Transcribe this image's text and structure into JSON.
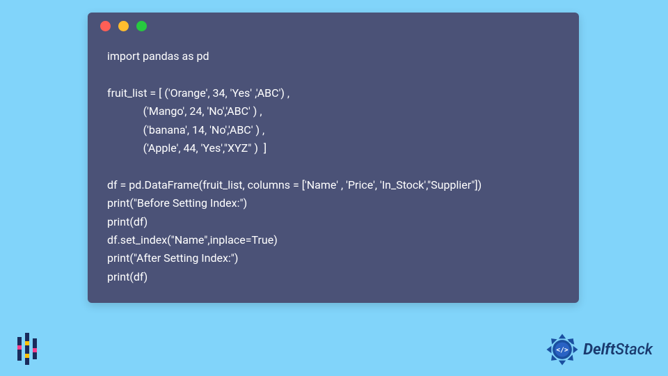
{
  "window": {
    "buttons": {
      "close": "red",
      "minimize": "yellow",
      "zoom": "green"
    }
  },
  "code": {
    "line1": "import pandas as pd",
    "blank1": "",
    "line2": "fruit_list = [ ('Orange', 34, 'Yes' ,'ABC') ,",
    "line3": "             ('Mango', 24, 'No','ABC' ) ,",
    "line4": "             ('banana', 14, 'No','ABC' ) ,",
    "line5": "             ('Apple', 44, 'Yes',\"XYZ\" )  ]",
    "blank2": "",
    "line6": "df = pd.DataFrame(fruit_list, columns = ['Name' , 'Price', 'In_Stock',\"Supplier\"])",
    "line7": "print(\"Before Setting Index:\")",
    "line8": "print(df)",
    "line9": "df.set_index(\"Name\",inplace=True)",
    "line10": "print(\"After Setting Index:\")",
    "line11": "print(df)"
  },
  "branding": {
    "delft": "Delft",
    "stack": "Stack"
  }
}
